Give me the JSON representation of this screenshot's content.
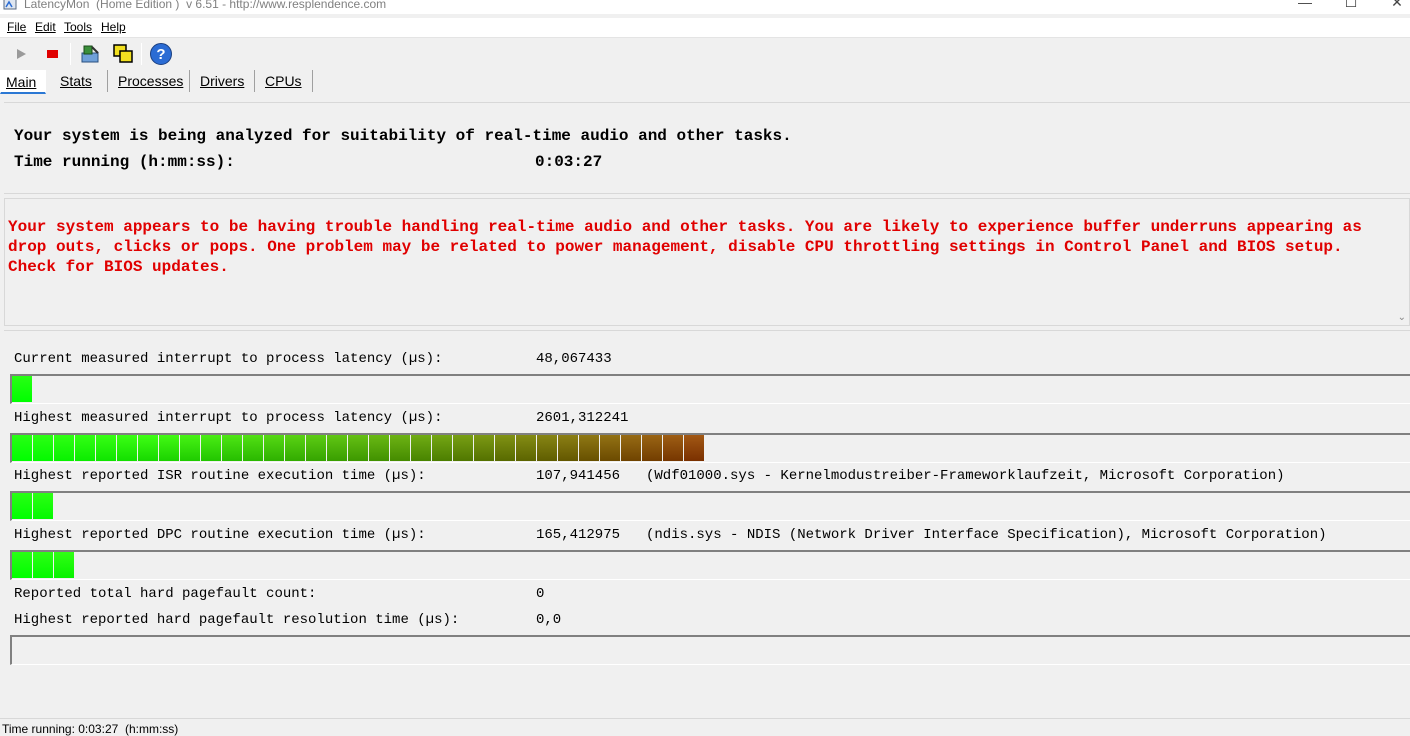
{
  "window": {
    "title": "LatencyMon  (Home Edition )  v 6.51 - http://www.resplendence.com",
    "min_glyph": "—",
    "max_glyph": "☐",
    "close_glyph": "✕"
  },
  "menu": [
    "File",
    "Edit",
    "Tools",
    "Help"
  ],
  "toolbar": {
    "buttons": [
      "play-icon",
      "stop-icon",
      "drivers-icon",
      "windows-icon",
      "help-icon"
    ],
    "help_glyph": "?"
  },
  "tabs": [
    "Main",
    "Stats",
    "Processes",
    "Drivers",
    "CPUs"
  ],
  "main": {
    "status_line": "Your system is being analyzed for suitability of real-time audio and other tasks.",
    "time_label": "Time running (h:mm:ss):",
    "time_value": "0:03:27",
    "warning": "Your system appears to be having trouble handling real-time audio and other tasks. You are likely to experience buffer underruns appearing as drop outs, clicks or pops. One problem may be related to power management, disable CPU throttling settings in Control Panel and BIOS setup. Check for BIOS updates."
  },
  "metrics": [
    {
      "label": "Current measured interrupt to process latency (µs):",
      "value": "48,067433",
      "extra": "",
      "bar_segments": 1
    },
    {
      "label": "Highest measured interrupt to process latency (µs):",
      "value": "2601,312241",
      "extra": "",
      "bar_segments": 33
    },
    {
      "label": "Highest reported ISR routine execution time (µs):",
      "value": "107,941456",
      "extra": "(Wdf01000.sys - Kernelmodustreiber-Frameworklaufzeit, Microsoft Corporation)",
      "bar_segments": 2
    },
    {
      "label": "Highest reported DPC routine execution time (µs):",
      "value": "165,412975",
      "extra": "(ndis.sys - NDIS (Network Driver Interface Specification), Microsoft Corporation)",
      "bar_segments": 3
    },
    {
      "label": "Reported total hard pagefault count:",
      "value": "0",
      "extra": ""
    },
    {
      "label": "Highest reported hard pagefault resolution time (µs):",
      "value": "0,0",
      "extra": "",
      "bar_segments": 0
    }
  ],
  "statusbar": {
    "text": "Time running: 0:03:27  (h:mm:ss)"
  },
  "colors": {
    "warning": "#e00000",
    "bar_start": "#00ff00",
    "bar_end": "#7a3000"
  }
}
